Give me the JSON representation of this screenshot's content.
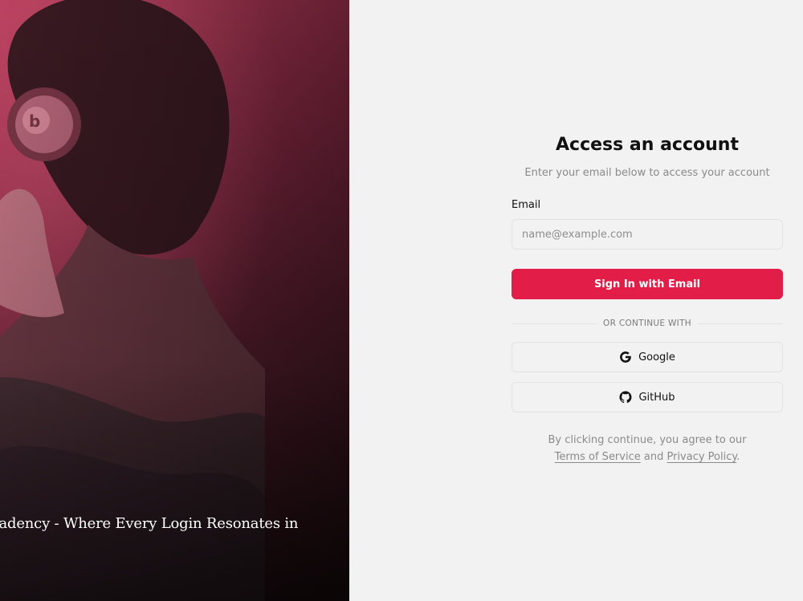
{
  "hero": {
    "caption": "n Cadency - Where Every Login Resonates in"
  },
  "auth": {
    "title": "Access an account",
    "subtitle": "Enter your email below to access your account",
    "email_label": "Email",
    "email_placeholder": "name@example.com",
    "email_value": "",
    "submit_label": "Sign In with Email",
    "divider_text": "OR CONTINUE WITH",
    "oauth": {
      "google": {
        "label": "Google",
        "icon": "google-icon"
      },
      "github": {
        "label": "GitHub",
        "icon": "github-icon"
      }
    },
    "legal": {
      "prefix": "By clicking continue, you agree to our",
      "terms_label": "Terms of Service",
      "and": "and",
      "privacy_label": "Privacy Policy",
      "suffix": "."
    }
  },
  "colors": {
    "accent": "#e11d48",
    "panel_bg": "#f2f2f2",
    "hero_gradient_start": "#b23a57",
    "hero_gradient_end": "#2a1418"
  }
}
